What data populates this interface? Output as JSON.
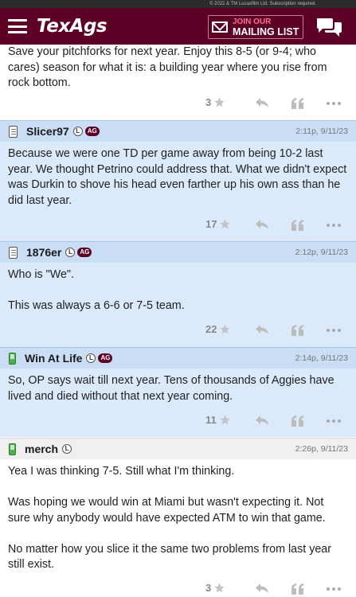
{
  "topbar": {
    "ad_text": "© 2022 & TM Lucasfilm Ltd. Subscription required."
  },
  "header": {
    "logo": "TexAgs",
    "mailing_line1": "JOIN OUR",
    "mailing_line2": "MAILING LIST"
  },
  "partial_post": {
    "text": "Save your pitchforks for next year. Enjoy this 8-5 (or 9-4; who cares) season for what it is: a building year where you rise from rock bottom.",
    "likes": "3"
  },
  "posts": [
    {
      "user": "Slicer97",
      "badge_l": "L",
      "badge_ag": "AG",
      "time": "2:11p, 9/11/23",
      "device": "tablet-icon",
      "paragraphs": [
        "Because we were one TD per game away from being 10-2 last year. We thought Petrino could address that. What we didn't expect was Durkin to shove his head even farther up his own ass than he did last year."
      ],
      "likes": "17"
    },
    {
      "user": "1876er",
      "badge_l": "L",
      "badge_ag": "AG",
      "time": "2:12p, 9/11/23",
      "device": "tablet-icon",
      "paragraphs": [
        "Who is \"We\".",
        "This was always a 6-6 or 7-5 team."
      ],
      "likes": "22"
    },
    {
      "user": "Win At Life",
      "badge_l": "L",
      "badge_ag": "AG",
      "time": "2:14p, 9/11/23",
      "device": "phone-icon",
      "paragraphs": [
        "So, OP says wait till next year. Tens of thousands of Aggies have lived and died without that next year coming."
      ],
      "likes": "11"
    },
    {
      "user": "merch",
      "badge_l": "L",
      "time": "2:26p, 9/11/23",
      "device": "phone-icon",
      "paragraphs": [
        "Yea I was thinking 7-5. Still what I'm thinking.",
        "Was hoping we would win at Miami but wasn't expecting it. Not sure why anybody would have expected ATM to win that game.",
        "No matter how you slice it the same two problems from last year still exist."
      ],
      "likes": "3"
    }
  ],
  "colors": {
    "maroon": "#5c0025",
    "post_blue": "#dbeafb",
    "post_header_blue": "#c9def5"
  }
}
